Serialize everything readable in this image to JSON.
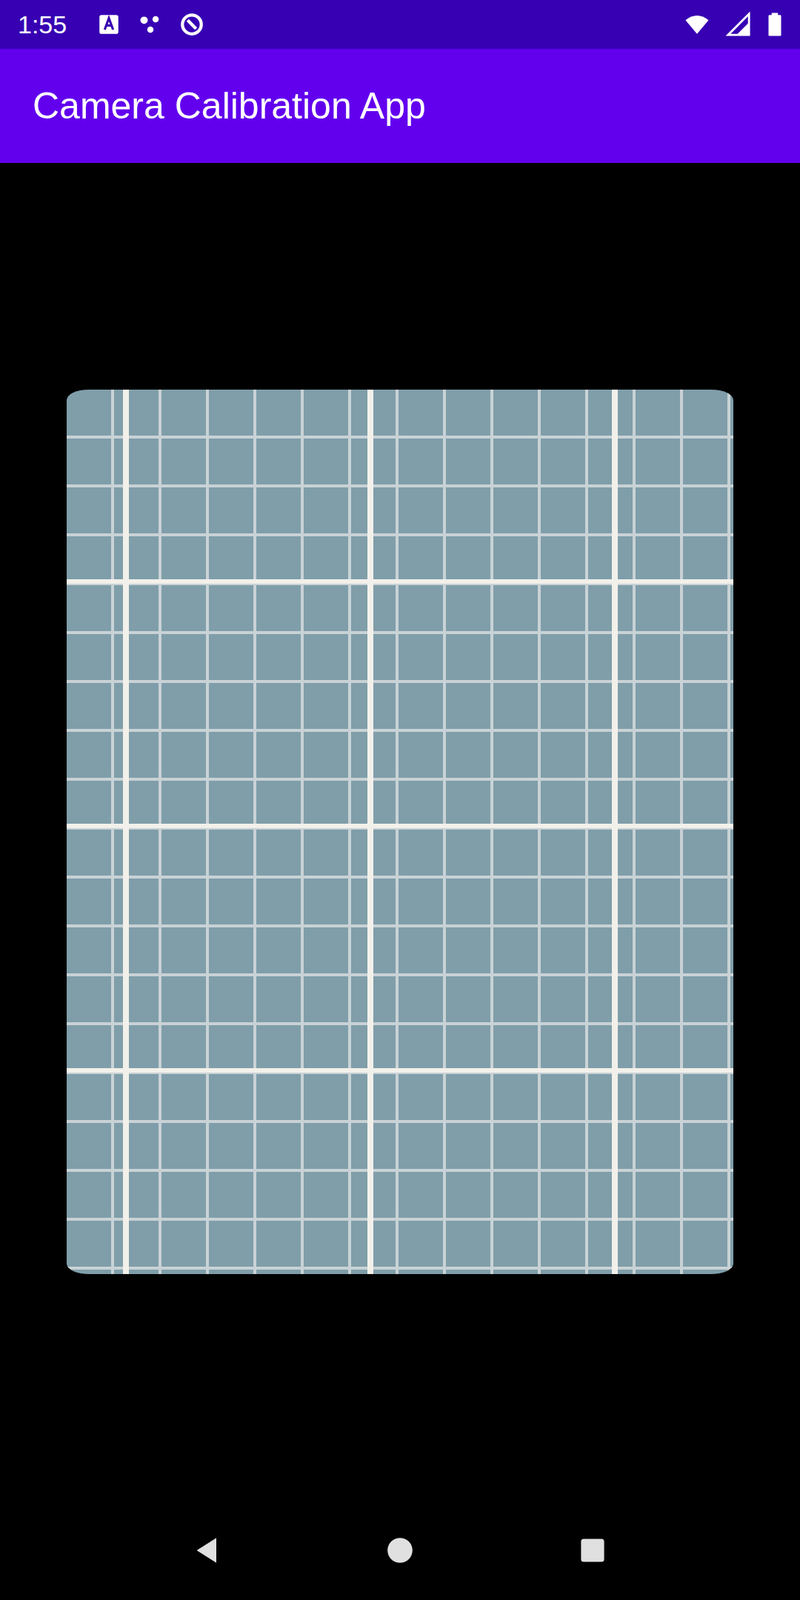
{
  "status_bar": {
    "time": "1:55"
  },
  "app_bar": {
    "title": "Camera Calibration App"
  }
}
